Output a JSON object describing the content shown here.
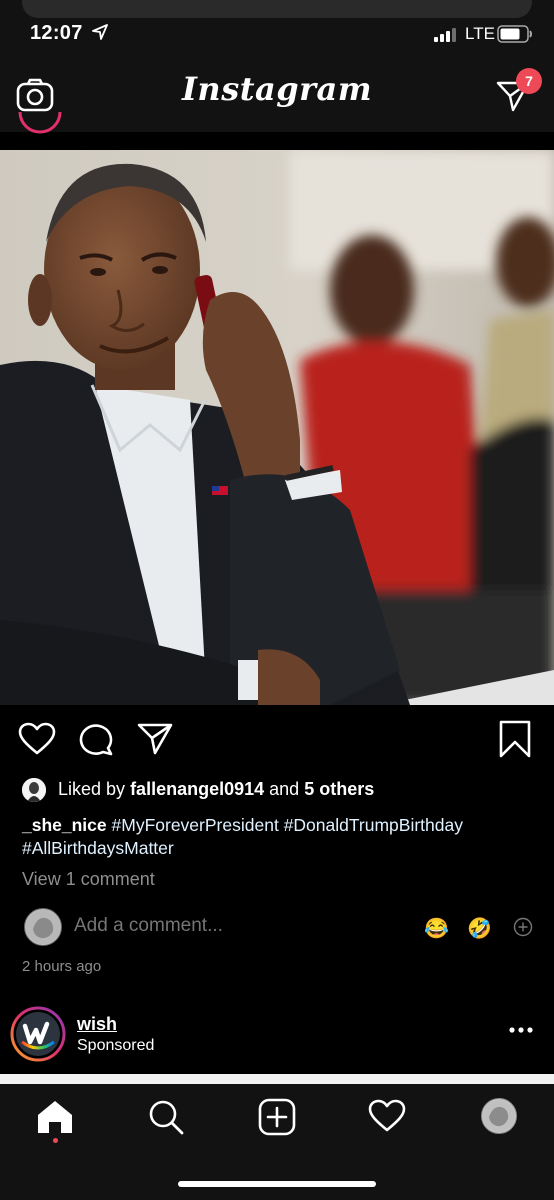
{
  "status_bar": {
    "time": "12:07",
    "network": "LTE"
  },
  "header": {
    "brand": "Instagram",
    "dm_badge_count": "7"
  },
  "post": {
    "liked_by_prefix": "Liked by",
    "liked_by_user": "fallenangel0914",
    "liked_by_and": "and",
    "liked_by_others": "5 others",
    "caption_user": "_she_nice",
    "caption_tags": [
      "#MyForeverPresident",
      "#DonaldTrumpBirthday",
      "#AllBirthdaysMatter"
    ],
    "view_comments": "View 1 comment",
    "comment_placeholder": "Add a comment...",
    "quick_emojis": [
      "😂",
      "🤣"
    ],
    "timestamp": "2 hours ago"
  },
  "sponsored": {
    "account": "wish",
    "label": "Sponsored"
  },
  "icons": {
    "header": [
      "camera-icon",
      "direct-message-icon"
    ],
    "actions": [
      "heart-icon",
      "comment-icon",
      "share-icon",
      "bookmark-icon",
      "add-emoji-icon",
      "more-icon"
    ],
    "nav": [
      "home-icon",
      "search-icon",
      "new-post-icon",
      "activity-heart-icon",
      "profile-avatar"
    ]
  },
  "colors": {
    "background": "#000000",
    "bars": "#121212",
    "badge": "#ed4956",
    "muted_text": "#8e8e8e",
    "hashtag": "#e0f1ff"
  }
}
